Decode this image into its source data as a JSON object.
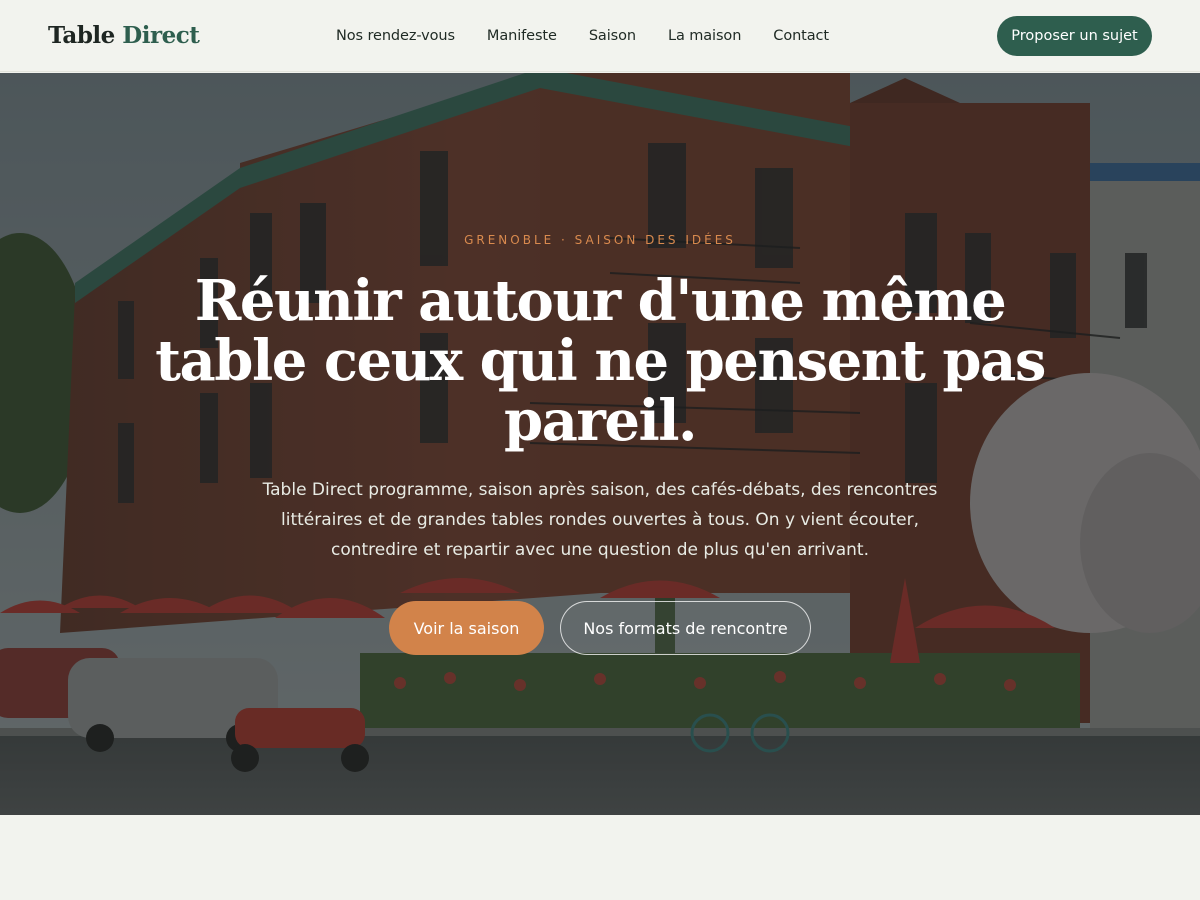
{
  "header": {
    "logo_main": "Table",
    "logo_accent": "Direct",
    "nav": [
      {
        "label": "Nos rendez-vous"
      },
      {
        "label": "Manifeste"
      },
      {
        "label": "Saison"
      },
      {
        "label": "La maison"
      },
      {
        "label": "Contact"
      }
    ],
    "cta_label": "Proposer un sujet"
  },
  "hero": {
    "eyebrow": "Grenoble · Saison des idées",
    "headline": "Réunir autour d'une même table ceux qui ne pensent pas pareil.",
    "lead": "Table Direct programme, saison après saison, des cafés-débats, des rencontres littéraires et de grandes tables rondes ouvertes à tous. On y vient écouter, contredire et repartir avec une question de plus qu'en arrivant.",
    "primary_button": "Voir la saison",
    "secondary_button": "Nos formats de rencontre",
    "image": "street-corner-cafe-photo"
  },
  "colors": {
    "brand_green": "#2e5e4e",
    "accent_orange": "#d2834a",
    "eyebrow_orange": "#d98a4e",
    "page_background": "#f2f3ee"
  }
}
